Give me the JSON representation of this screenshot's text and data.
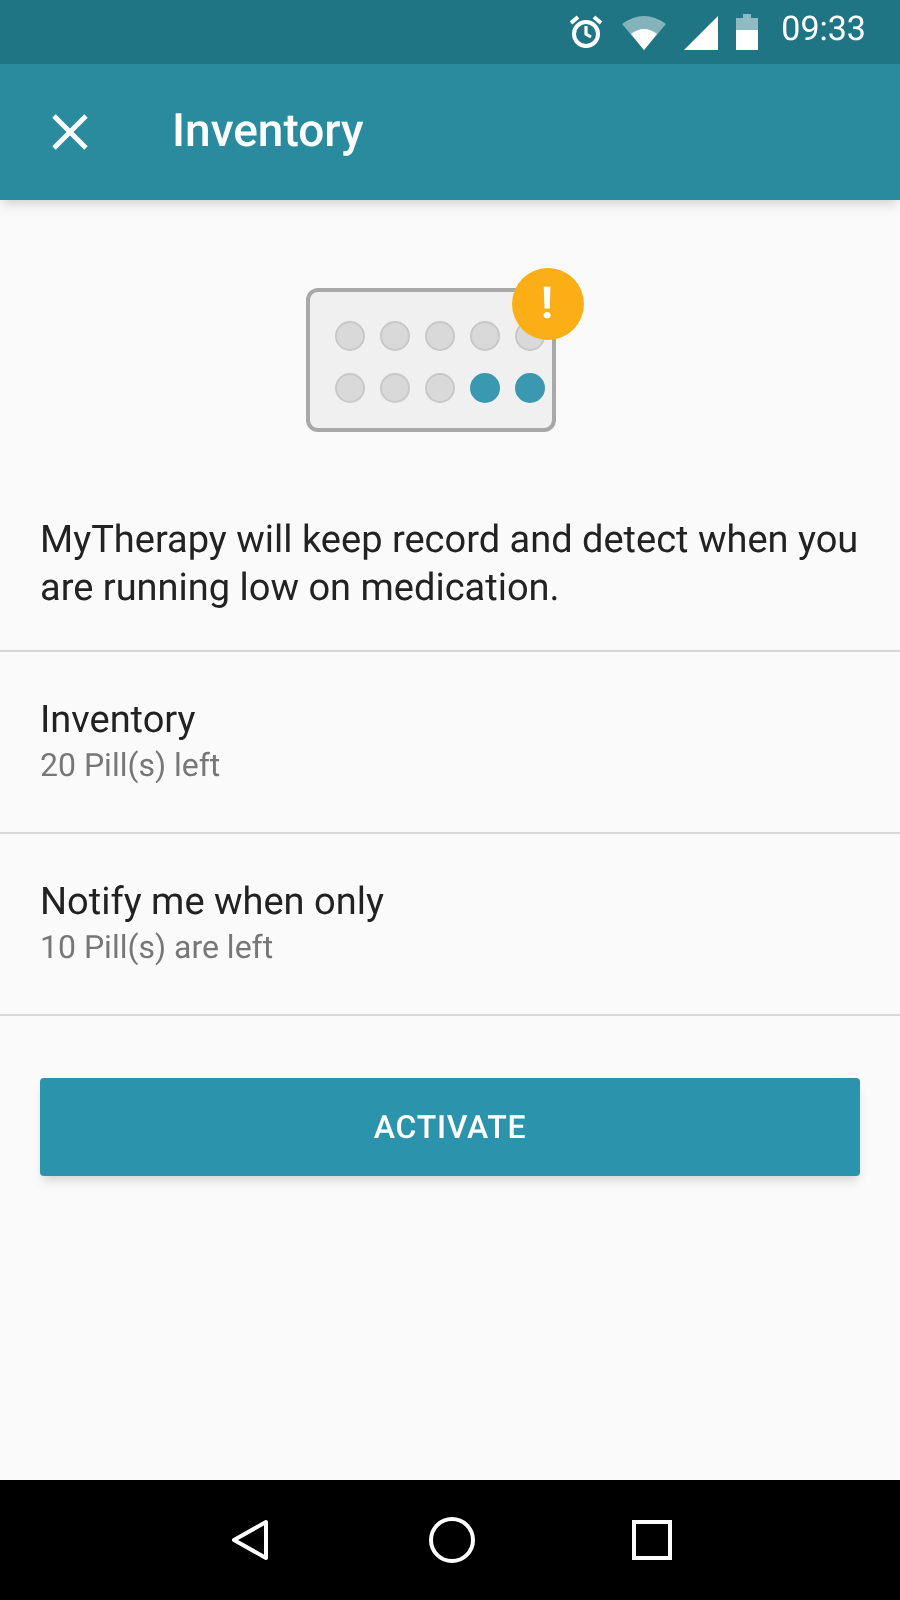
{
  "status_bar": {
    "time": "09:33"
  },
  "app_bar": {
    "title": "Inventory"
  },
  "illustration": {
    "badge": "!",
    "pills": [
      {
        "filled": false
      },
      {
        "filled": false
      },
      {
        "filled": false
      },
      {
        "filled": false
      },
      {
        "filled": false
      },
      {
        "filled": false
      },
      {
        "filled": false
      },
      {
        "filled": false
      },
      {
        "filled": true
      },
      {
        "filled": true
      }
    ]
  },
  "description": "MyTherapy will keep record and detect when you are running low on medication.",
  "settings": [
    {
      "title": "Inventory",
      "value": "20 Pill(s) left"
    },
    {
      "title": "Notify me when only",
      "value": "10 Pill(s) are left"
    }
  ],
  "button": "ACTIVATE"
}
